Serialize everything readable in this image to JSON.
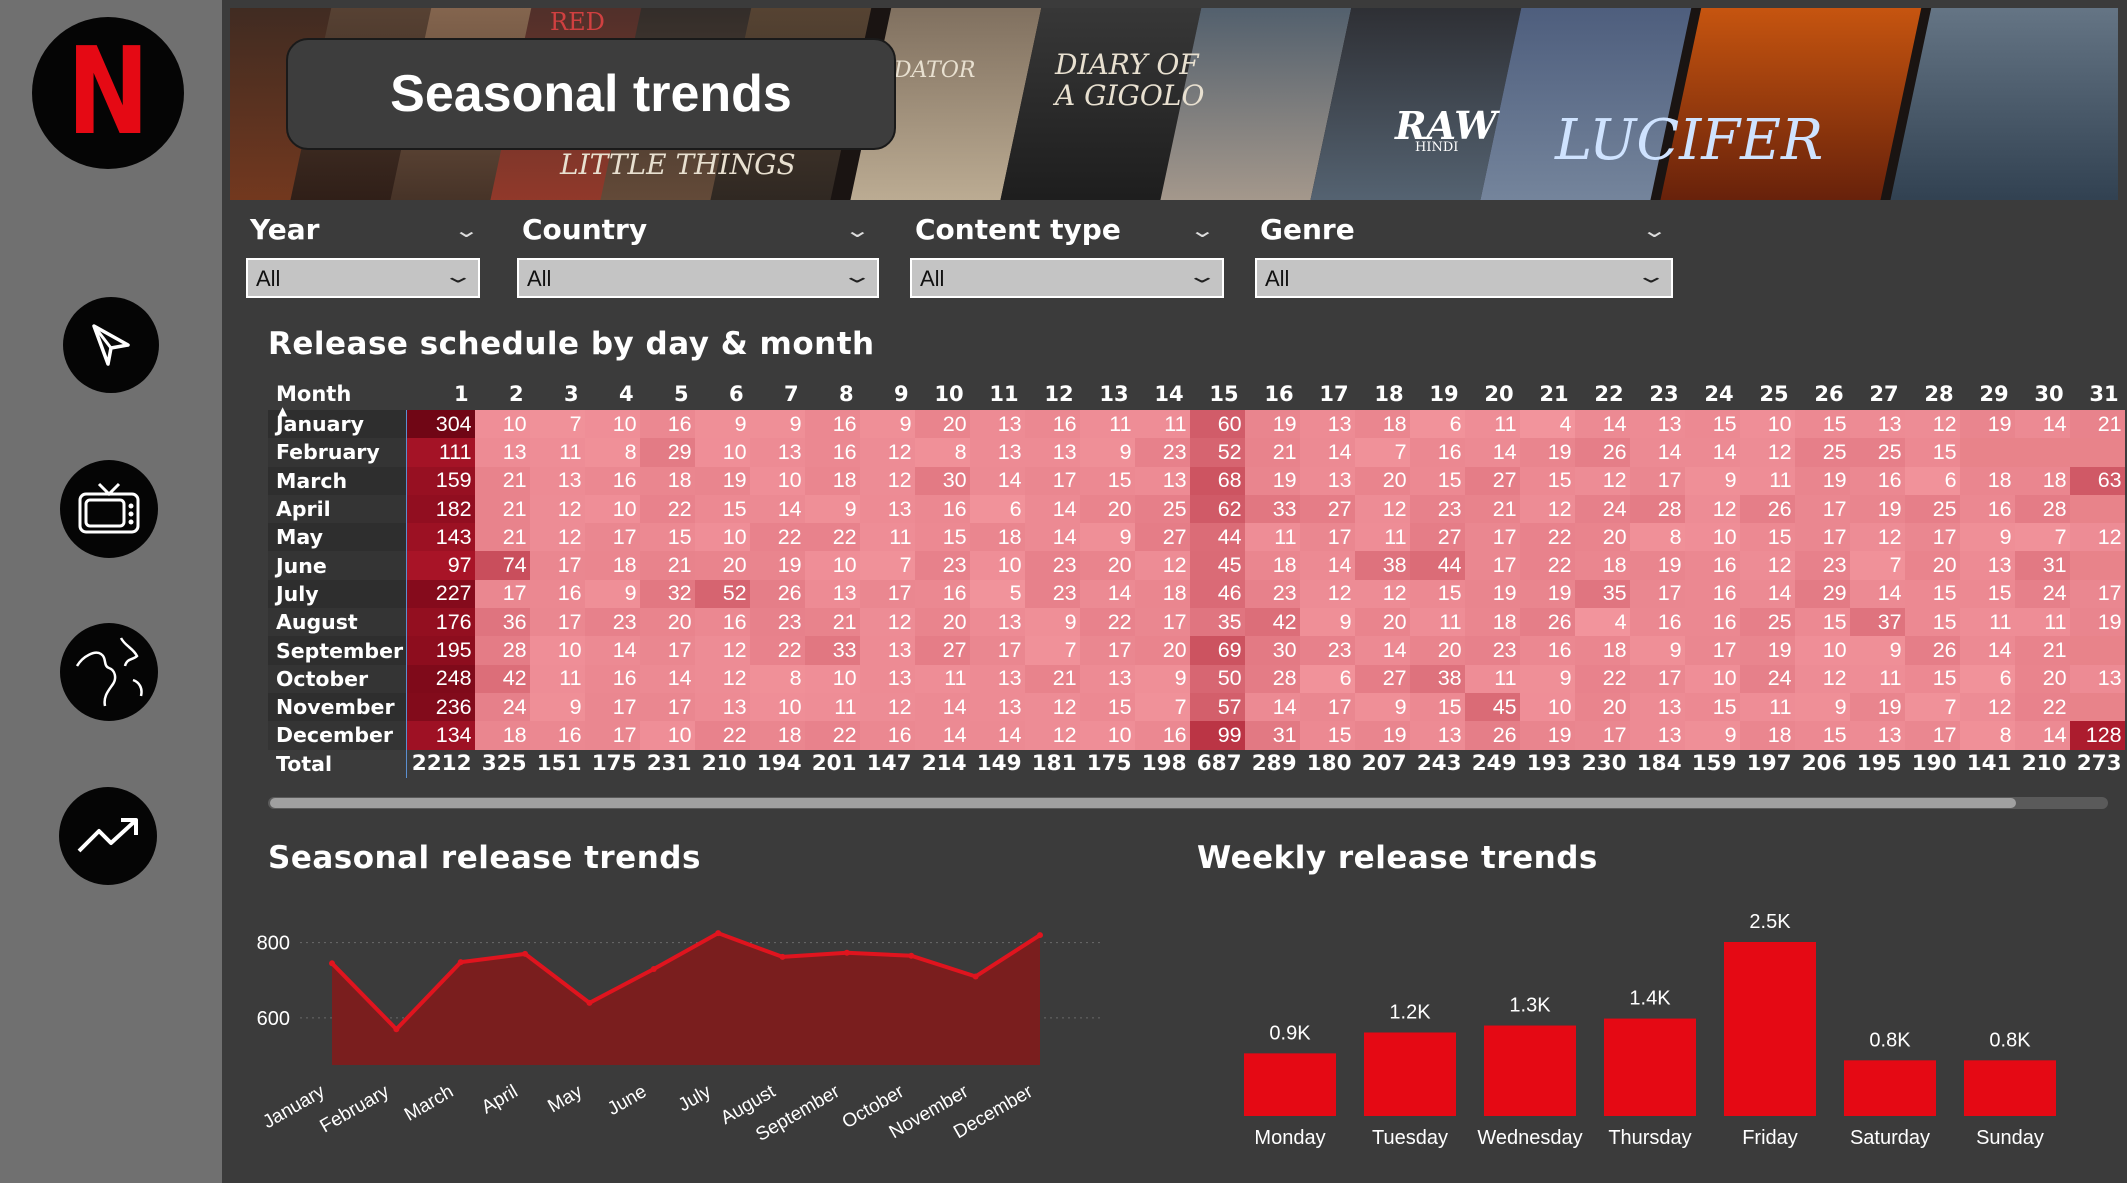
{
  "page_title": "Seasonal trends",
  "banner": {
    "texts": [
      "INDIAN PREDATOR",
      "DIARY OF A GIGOLO",
      "LITTLE THINGS",
      "RAW",
      "HINDI",
      "LUCIFER",
      "RED"
    ]
  },
  "sidebar": {
    "items": [
      {
        "icon": "netflix-logo",
        "letter": "N"
      },
      {
        "icon": "compass-icon"
      },
      {
        "icon": "tv-icon"
      },
      {
        "icon": "globe-icon"
      },
      {
        "icon": "trend-up-icon"
      }
    ]
  },
  "filters": [
    {
      "label": "Year",
      "value": "All"
    },
    {
      "label": "Country",
      "value": "All"
    },
    {
      "label": "Content type",
      "value": "All"
    },
    {
      "label": "Genre",
      "value": "All"
    }
  ],
  "matrix": {
    "title": "Release schedule by day & month",
    "corner_label": "Month",
    "days": [
      "1",
      "2",
      "3",
      "4",
      "5",
      "6",
      "7",
      "8",
      "9",
      "10",
      "11",
      "12",
      "13",
      "14",
      "15",
      "16",
      "17",
      "18",
      "19",
      "20",
      "21",
      "22",
      "23",
      "24",
      "25",
      "26",
      "27",
      "28",
      "29",
      "30",
      "31"
    ],
    "rows": [
      {
        "month": "January",
        "values": [
          304,
          10,
          7,
          10,
          16,
          9,
          9,
          16,
          9,
          20,
          13,
          16,
          11,
          11,
          60,
          19,
          13,
          18,
          6,
          11,
          4,
          14,
          13,
          15,
          10,
          15,
          13,
          12,
          19,
          14,
          21
        ]
      },
      {
        "month": "February",
        "values": [
          111,
          13,
          11,
          8,
          29,
          10,
          13,
          16,
          12,
          8,
          13,
          13,
          9,
          23,
          52,
          21,
          14,
          7,
          16,
          14,
          19,
          26,
          14,
          14,
          12,
          25,
          25,
          15,
          null,
          null,
          null
        ]
      },
      {
        "month": "March",
        "values": [
          159,
          21,
          13,
          16,
          18,
          19,
          10,
          18,
          12,
          30,
          14,
          17,
          15,
          13,
          68,
          19,
          13,
          20,
          15,
          27,
          15,
          12,
          17,
          9,
          11,
          19,
          16,
          6,
          18,
          18,
          63
        ]
      },
      {
        "month": "April",
        "values": [
          182,
          21,
          12,
          10,
          22,
          15,
          14,
          9,
          13,
          16,
          6,
          14,
          20,
          25,
          62,
          33,
          27,
          12,
          23,
          21,
          12,
          24,
          28,
          12,
          26,
          17,
          19,
          25,
          16,
          28,
          null
        ]
      },
      {
        "month": "May",
        "values": [
          143,
          21,
          12,
          17,
          15,
          10,
          22,
          22,
          11,
          15,
          18,
          14,
          9,
          27,
          44,
          11,
          17,
          11,
          27,
          17,
          22,
          20,
          8,
          10,
          15,
          17,
          12,
          17,
          9,
          7,
          12
        ]
      },
      {
        "month": "June",
        "values": [
          97,
          74,
          17,
          18,
          21,
          20,
          19,
          10,
          7,
          23,
          10,
          23,
          20,
          12,
          45,
          18,
          14,
          38,
          44,
          17,
          22,
          18,
          19,
          16,
          12,
          23,
          7,
          20,
          13,
          31,
          null
        ]
      },
      {
        "month": "July",
        "values": [
          227,
          17,
          16,
          9,
          32,
          52,
          26,
          13,
          17,
          16,
          5,
          23,
          14,
          18,
          46,
          23,
          12,
          12,
          15,
          19,
          19,
          35,
          17,
          16,
          14,
          29,
          14,
          15,
          15,
          24,
          17
        ]
      },
      {
        "month": "August",
        "values": [
          176,
          36,
          17,
          23,
          20,
          16,
          23,
          21,
          12,
          20,
          13,
          9,
          22,
          17,
          35,
          42,
          9,
          20,
          11,
          18,
          26,
          4,
          16,
          16,
          25,
          15,
          37,
          15,
          11,
          11,
          19
        ]
      },
      {
        "month": "September",
        "values": [
          195,
          28,
          10,
          14,
          17,
          12,
          22,
          33,
          13,
          27,
          17,
          7,
          17,
          20,
          69,
          30,
          23,
          14,
          20,
          23,
          16,
          18,
          9,
          17,
          19,
          10,
          9,
          26,
          14,
          21,
          null
        ]
      },
      {
        "month": "October",
        "values": [
          248,
          42,
          11,
          16,
          14,
          12,
          8,
          10,
          13,
          11,
          13,
          21,
          13,
          9,
          50,
          28,
          6,
          27,
          38,
          11,
          9,
          22,
          17,
          10,
          24,
          12,
          11,
          15,
          6,
          20,
          13
        ]
      },
      {
        "month": "November",
        "values": [
          236,
          24,
          9,
          17,
          17,
          13,
          10,
          11,
          12,
          14,
          13,
          12,
          15,
          7,
          57,
          14,
          17,
          9,
          15,
          45,
          10,
          20,
          13,
          15,
          11,
          9,
          19,
          7,
          12,
          22,
          null
        ]
      },
      {
        "month": "December",
        "values": [
          134,
          18,
          16,
          17,
          10,
          22,
          18,
          22,
          16,
          14,
          14,
          12,
          10,
          16,
          99,
          31,
          15,
          19,
          13,
          26,
          19,
          17,
          13,
          9,
          18,
          15,
          13,
          17,
          8,
          14,
          128
        ]
      }
    ],
    "total_label": "Total",
    "totals": [
      2212,
      325,
      151,
      175,
      231,
      210,
      194,
      201,
      147,
      214,
      149,
      181,
      175,
      198,
      687,
      289,
      180,
      207,
      243,
      249,
      193,
      230,
      184,
      159,
      197,
      206,
      195,
      190,
      141,
      210,
      273
    ]
  },
  "seasonal_chart_title": "Seasonal release trends",
  "weekly_chart_title": "Weekly release trends",
  "colors": {
    "accent": "#e50914",
    "area_fill": "#7a1e1e",
    "line": "#e0141e",
    "sidebar": "#707070",
    "background": "#3b3b3b"
  },
  "chart_data": [
    {
      "type": "area",
      "title": "Seasonal release trends",
      "categories": [
        "January",
        "February",
        "March",
        "April",
        "May",
        "June",
        "July",
        "August",
        "September",
        "October",
        "November",
        "December"
      ],
      "values": [
        745,
        570,
        748,
        770,
        640,
        730,
        825,
        762,
        773,
        765,
        710,
        820
      ],
      "yticks": [
        600,
        800
      ],
      "ylim": [
        475,
        860
      ],
      "grid": true
    },
    {
      "type": "bar",
      "title": "Weekly release trends",
      "categories": [
        "Monday",
        "Tuesday",
        "Wednesday",
        "Thursday",
        "Friday",
        "Saturday",
        "Sunday"
      ],
      "values": [
        0.9,
        1.2,
        1.3,
        1.4,
        2.5,
        0.8,
        0.8
      ],
      "labels": [
        "0.9K",
        "1.2K",
        "1.3K",
        "1.4K",
        "2.5K",
        "0.8K",
        "0.8K"
      ],
      "unit": "K"
    }
  ]
}
